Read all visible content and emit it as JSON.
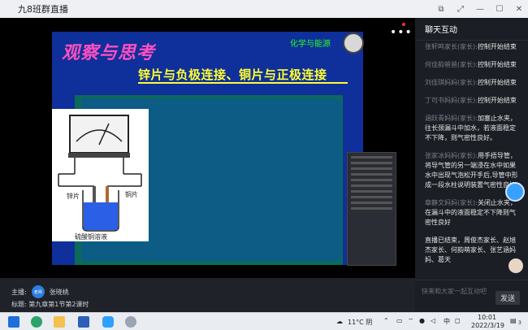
{
  "window": {
    "title": "九8班群直播",
    "controls": [
      "restore-down-icon",
      "fullscreen-icon",
      "minimize-icon",
      "maximize-icon",
      "close-icon"
    ]
  },
  "slide": {
    "banner": "观察与思考",
    "topic": "化学与能源",
    "subtitle": "锌片与负极连接、铜片与正极连接",
    "labels": {
      "zinc": "锌片",
      "copper": "铜片",
      "solution": "硫酸铜溶液"
    }
  },
  "video_overlay": {
    "more": "•••"
  },
  "chat": {
    "header": "聊天互动",
    "messages": [
      {
        "sender": "张轩鸣家长(家长):",
        "text": "控制开始结束"
      },
      {
        "sender": "何佳韵爸爸(家长):",
        "text": "控制开始结束"
      },
      {
        "sender": "刘佳琪妈妈(家长):",
        "text": "控制开始结束"
      },
      {
        "sender": "丁可书妈妈(家长):",
        "text": "控制开始结束"
      },
      {
        "sender": "涵跃青妈妈(家长):",
        "text": "加塞止水夹，往长颈漏斗中加水，若液面稳定不下降，则气密性良好。"
      },
      {
        "sender": "张家冰妈妈(家长):",
        "text": "用手捂导管，将导气管的另一端浸在水中如果水中出现气泡松开手后,导管中形成一段水柱说明装置气密性良好"
      },
      {
        "sender": "章静文妈妈(家长):",
        "text": "关闭止水夹，在漏斗中的液面稳定不下降则气密性良好"
      },
      {
        "sender": "",
        "text": "直播已结束，周俊杰家长、赵旭杰家长、何韵萌家长、张艺涵妈妈、葛天"
      }
    ],
    "input_placeholder": "快来和大家一起互动吧",
    "send_label": "发送"
  },
  "info": {
    "host_label": "主播:",
    "host_badge": "老师",
    "host_name": "张晓桃",
    "topic_label": "标题:",
    "topic_value": "第九章第1节第2课时"
  },
  "taskbar": {
    "weather": "11°C 阴",
    "ime": "中",
    "time": "10:01",
    "date": "2022/3/19",
    "notifications": "3"
  }
}
